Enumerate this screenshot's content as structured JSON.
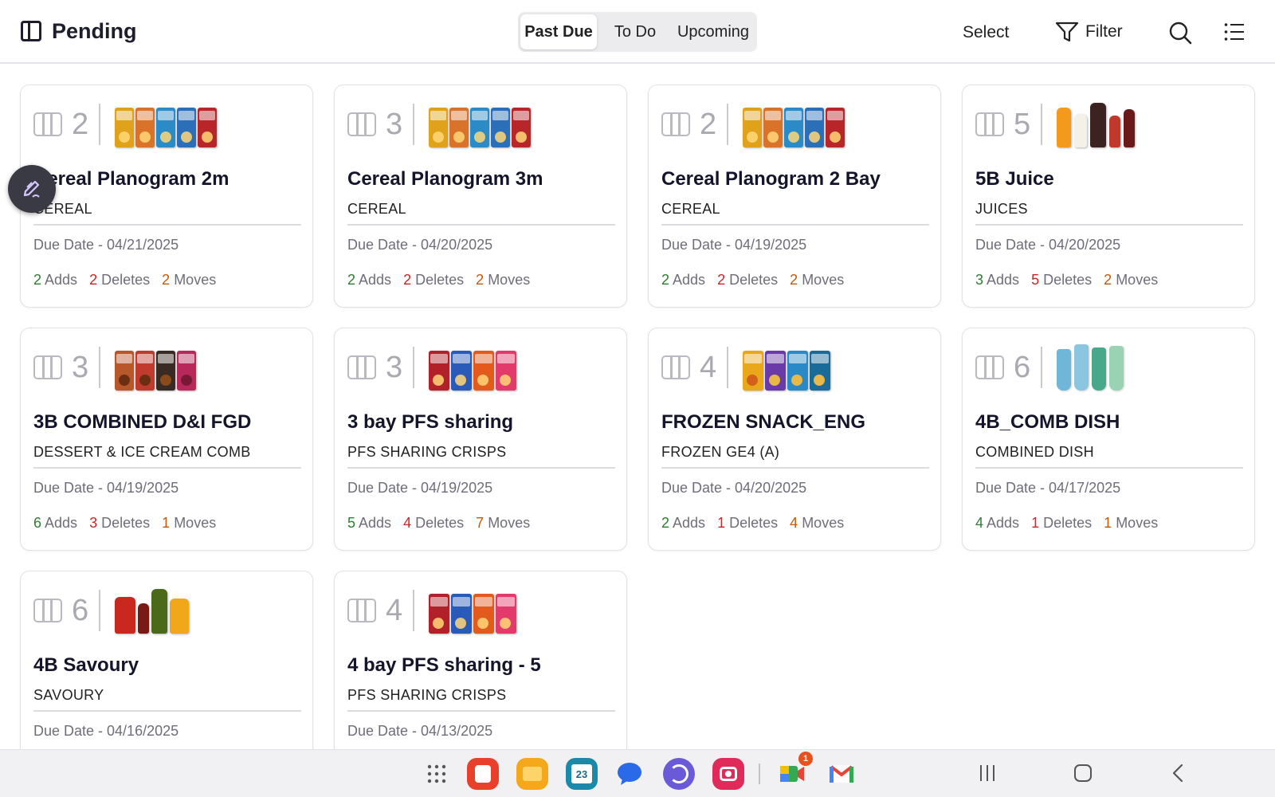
{
  "header": {
    "title": "Pending",
    "tabs": [
      "Past Due",
      "To Do",
      "Upcoming"
    ],
    "active_tab": "Past Due",
    "select_label": "Select",
    "filter_label": "Filter"
  },
  "colors": {
    "adds": "#2e7d32",
    "deletes": "#c62828",
    "moves": "#c45a0a"
  },
  "cards": [
    {
      "bays": "2",
      "title": "Cereal Planogram 2m",
      "category": "CEREAL",
      "due": "Due Date - 04/21/2025",
      "adds": "2",
      "deletes": "2",
      "moves": "2",
      "adds_label": "Adds",
      "deletes_label": "Deletes",
      "moves_label": "Moves",
      "thumb_icon": "cereal-boxes-icon"
    },
    {
      "bays": "3",
      "title": "Cereal Planogram 3m",
      "category": "CEREAL",
      "due": "Due Date - 04/20/2025",
      "adds": "2",
      "deletes": "2",
      "moves": "2",
      "adds_label": "Adds",
      "deletes_label": "Deletes",
      "moves_label": "Moves",
      "thumb_icon": "cereal-boxes-icon"
    },
    {
      "bays": "2",
      "title": "Cereal Planogram 2 Bay",
      "category": "CEREAL",
      "due": "Due Date - 04/19/2025",
      "adds": "2",
      "deletes": "2",
      "moves": "2",
      "adds_label": "Adds",
      "deletes_label": "Deletes",
      "moves_label": "Moves",
      "thumb_icon": "cereal-boxes-icon"
    },
    {
      "bays": "5",
      "title": "5B Juice",
      "category": "JUICES",
      "due": "Due Date - 04/20/2025",
      "adds": "3",
      "deletes": "5",
      "moves": "2",
      "adds_label": "Adds",
      "deletes_label": "Deletes",
      "moves_label": "Moves",
      "thumb_icon": "juice-bottles-icon"
    },
    {
      "bays": "3",
      "title": "3B COMBINED D&I FGD",
      "category": "DESSERT & ICE CREAM COMB",
      "due": "Due Date - 04/19/2025",
      "adds": "6",
      "deletes": "3",
      "moves": "1",
      "adds_label": "Adds",
      "deletes_label": "Deletes",
      "moves_label": "Moves",
      "thumb_icon": "dessert-boxes-icon"
    },
    {
      "bays": "3",
      "title": "3  bay PFS sharing",
      "category": "PFS SHARING CRISPS",
      "due": "Due Date - 04/19/2025",
      "adds": "5",
      "deletes": "4",
      "moves": "7",
      "adds_label": "Adds",
      "deletes_label": "Deletes",
      "moves_label": "Moves",
      "thumb_icon": "crisps-bags-icon"
    },
    {
      "bays": "4",
      "title": "FROZEN SNACK_ENG",
      "category": "FROZEN GE4 (A)",
      "due": "Due Date - 04/20/2025",
      "adds": "2",
      "deletes": "1",
      "moves": "4",
      "adds_label": "Adds",
      "deletes_label": "Deletes",
      "moves_label": "Moves",
      "thumb_icon": "frozen-snack-boxes-icon"
    },
    {
      "bays": "6",
      "title": "4B_COMB DISH",
      "category": "COMBINED DISH",
      "due": "Due Date - 04/17/2025",
      "adds": "4",
      "deletes": "1",
      "moves": "1",
      "adds_label": "Adds",
      "deletes_label": "Deletes",
      "moves_label": "Moves",
      "thumb_icon": "dish-tubes-icon"
    },
    {
      "bays": "6",
      "title": "4B Savoury",
      "category": "SAVOURY",
      "due": "Due Date - 04/16/2025",
      "adds": "",
      "deletes": "",
      "moves": "",
      "adds_label": "",
      "deletes_label": "",
      "moves_label": "",
      "thumb_icon": "savoury-jars-icon"
    },
    {
      "bays": "4",
      "title": "4  bay PFS sharing - 5",
      "category": "PFS SHARING CRISPS",
      "due": "Due Date - 04/13/2025",
      "adds": "",
      "deletes": "",
      "moves": "",
      "adds_label": "",
      "deletes_label": "",
      "moves_label": "",
      "thumb_icon": "crisps-bags-icon"
    }
  ],
  "taskbar": {
    "apps": [
      "app-drawer-icon",
      "notes-app-icon",
      "files-app-icon",
      "calendar-app-icon",
      "messages-app-icon",
      "internet-app-icon",
      "camera-app-icon",
      "meet-app-icon",
      "gmail-app-icon"
    ],
    "calendar_date": "23",
    "meet_badge": "1"
  }
}
